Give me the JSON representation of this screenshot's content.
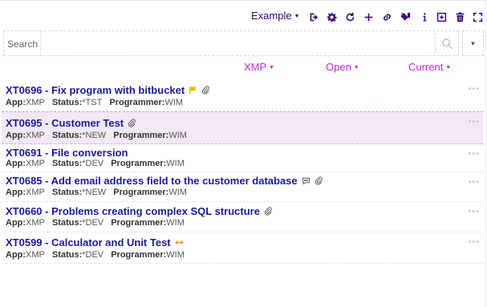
{
  "toolbar": {
    "example_label": "Example",
    "icons": [
      "exit-icon",
      "gear-icon",
      "refresh-icon",
      "plus-icon",
      "link-icon",
      "tag-icon",
      "info-icon",
      "add-box-icon",
      "trash-icon",
      "fullscreen-icon"
    ]
  },
  "search": {
    "label": "Search",
    "placeholder": "",
    "value": ""
  },
  "filters": {
    "app": "XMP",
    "status": "Open",
    "period": "Current"
  },
  "labels": {
    "app": "App:",
    "status": "Status:",
    "programmer": "Programmer:"
  },
  "items": [
    {
      "id": "XT0696",
      "title": "XT0696 - Fix program with bitbucket",
      "app": "XMP",
      "status": "*TST",
      "programmer": "WIM"
    },
    {
      "id": "XT0695",
      "title": "XT0695 - Customer Test",
      "app": "XMP",
      "status": "*NEW",
      "programmer": "WIM"
    },
    {
      "id": "XT0691",
      "title": "XT0691 - File conversion",
      "app": "XMP",
      "status": "*DEV",
      "programmer": "WIM"
    },
    {
      "id": "XT0685",
      "title": "XT0685 - Add email address field to the customer database",
      "app": "XMP",
      "status": "*NEW",
      "programmer": "WIM"
    },
    {
      "id": "XT0660",
      "title": "XT0660 - Problems creating complex SQL structure",
      "app": "XMP",
      "status": "*DEV",
      "programmer": "WIM"
    },
    {
      "id": "XT0599",
      "title": "XT0599 - Calculator and Unit Test",
      "app": "XMP",
      "status": "*DEV",
      "programmer": "WIM"
    }
  ],
  "colors": {
    "title": "#1a1a9c",
    "filter": "#c223e6",
    "toolbar_icon": "#3d0a7a",
    "selected_bg": "#f2e9f5",
    "flag": "#f5b400",
    "arrows": "#f5a000"
  }
}
